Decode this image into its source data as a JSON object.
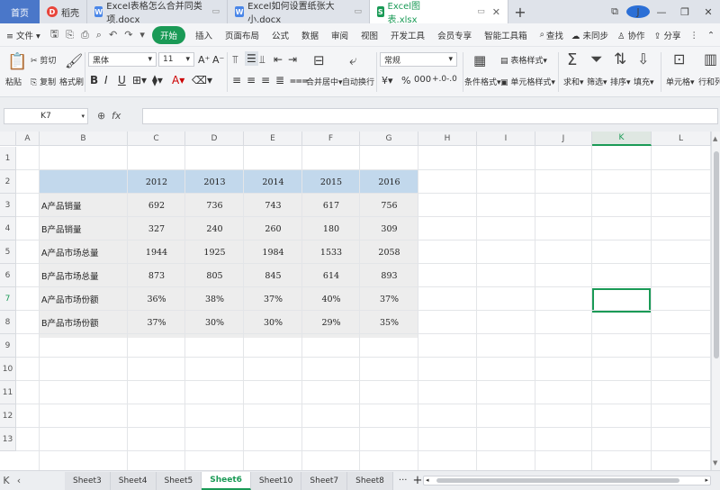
{
  "titlebar": {
    "home": "首页",
    "tabs": [
      {
        "label": "稻壳",
        "icon_color": "#e8443a",
        "icon": "D"
      },
      {
        "label": "Excel表格怎么合并同类项.docx",
        "icon_color": "#4a86e8",
        "icon": "W"
      },
      {
        "label": "Excel如何设置纸张大小.docx",
        "icon_color": "#4a86e8",
        "icon": "W"
      },
      {
        "label": "Excel图表.xlsx",
        "icon_color": "#1a9a56",
        "icon": "S"
      }
    ],
    "window_controls": [
      "⧉",
      "J",
      "—",
      "❐",
      "✕"
    ]
  },
  "menubar": {
    "file": "文件",
    "items": [
      "开始",
      "插入",
      "页面布局",
      "公式",
      "数据",
      "审阅",
      "视图",
      "开发工具",
      "会员专享",
      "智能工具箱"
    ],
    "search": "查找",
    "right": [
      "未同步",
      "协作",
      "分享"
    ]
  },
  "ribbon": {
    "paste": "粘贴",
    "cut": "剪切",
    "copy": "复制",
    "format_painter": "格式刷",
    "font_name": "黑体",
    "font_size": "11",
    "merge_center": "合并居中",
    "wrap": "自动换行",
    "number_format": "常规",
    "cond_format": "条件格式",
    "table_style": "表格样式",
    "cell_style": "单元格样式",
    "sum": "求和",
    "filter": "筛选",
    "sort": "排序",
    "fill": "填充",
    "cell": "单元格",
    "rowcol": "行和列"
  },
  "formula_bar": {
    "name_box": "K7",
    "fx": "fx",
    "value": ""
  },
  "grid": {
    "columns": [
      "A",
      "B",
      "C",
      "D",
      "E",
      "F",
      "G",
      "H",
      "I",
      "J",
      "K",
      "L"
    ],
    "rows": [
      "1",
      "2",
      "3",
      "4",
      "5",
      "6",
      "7",
      "8",
      "9",
      "10",
      "11",
      "12",
      "13"
    ],
    "years": [
      "2012",
      "2013",
      "2014",
      "2015",
      "2016"
    ],
    "data": [
      {
        "label": "A产品销量",
        "values": [
          "692",
          "736",
          "743",
          "617",
          "756"
        ]
      },
      {
        "label": "B产品销量",
        "values": [
          "327",
          "240",
          "260",
          "180",
          "309"
        ]
      },
      {
        "label": "A产品市场总量",
        "values": [
          "1944",
          "1925",
          "1984",
          "1533",
          "2058"
        ]
      },
      {
        "label": "B产品市场总量",
        "values": [
          "873",
          "805",
          "845",
          "614",
          "893"
        ]
      },
      {
        "label": "A产品市场份额",
        "values": [
          "36%",
          "38%",
          "37%",
          "40%",
          "37%"
        ]
      },
      {
        "label": "B产品市场份额",
        "values": [
          "37%",
          "30%",
          "30%",
          "29%",
          "35%"
        ]
      }
    ]
  },
  "sheets": {
    "tabs": [
      "Sheet3",
      "Sheet4",
      "Sheet5",
      "Sheet6",
      "Sheet10",
      "Sheet7",
      "Sheet8"
    ],
    "active": "Sheet6",
    "more": "···",
    "add": "+"
  }
}
